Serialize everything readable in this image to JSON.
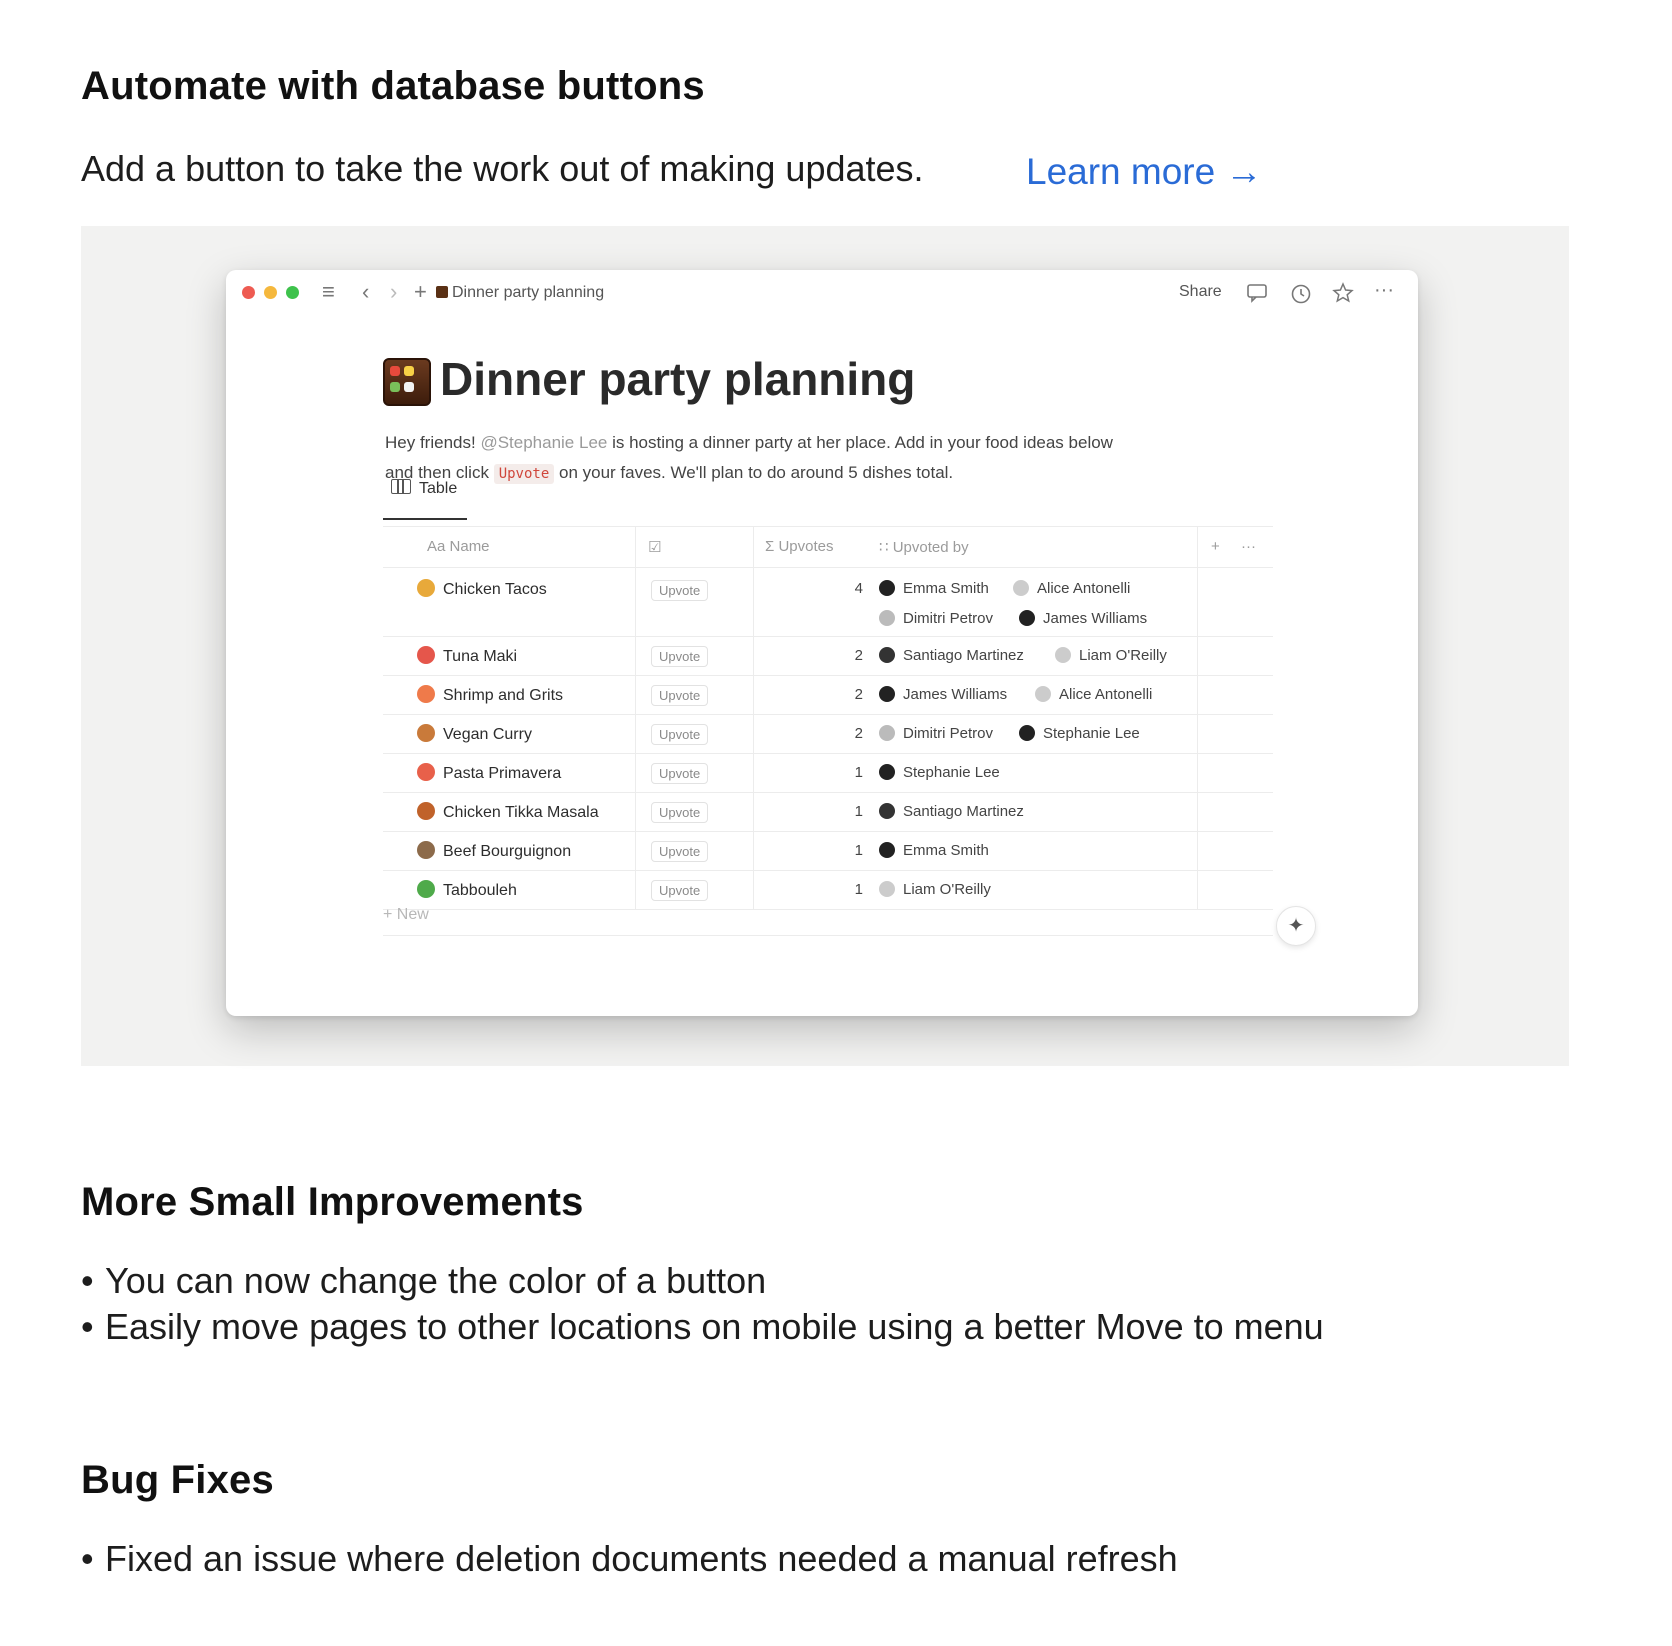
{
  "section1": {
    "title": "Automate with database buttons",
    "lead": "Add a button to take the work out of making updates.",
    "learn_more": "Learn more →"
  },
  "window": {
    "breadcrumb": "Dinner party planning",
    "share": "Share",
    "page_title": "Dinner party planning",
    "desc_line1_a": "Hey friends! ",
    "desc_mention": "@Stephanie Lee",
    "desc_line1_b": " is hosting a dinner party at her place. Add in your food ideas below",
    "desc_line2_a": "and then click ",
    "desc_code": "Upvote",
    "desc_line2_b": " on your faves. We'll plan to do around 5 dishes total.",
    "tab": "Table",
    "columns": {
      "name": "Aa  Name",
      "button_col": "☑",
      "upvotes": "Σ  Upvotes",
      "upvoted_by": "∷  Upvoted by"
    },
    "add_column": "+",
    "more": "···",
    "button_label": "Upvote",
    "rows": [
      {
        "name": "Chicken Tacos",
        "count": "4",
        "people": [
          "Emma Smith",
          "Alice Antonelli",
          "Dimitri Petrov",
          "James Williams"
        ]
      },
      {
        "name": "Tuna Maki",
        "count": "2",
        "people": [
          "Santiago Martinez",
          "Liam O'Reilly"
        ]
      },
      {
        "name": "Shrimp and Grits",
        "count": "2",
        "people": [
          "James Williams",
          "Alice Antonelli"
        ]
      },
      {
        "name": "Vegan Curry",
        "count": "2",
        "people": [
          "Dimitri Petrov",
          "Stephanie Lee"
        ]
      },
      {
        "name": "Pasta Primavera",
        "count": "1",
        "people": [
          "Stephanie Lee"
        ]
      },
      {
        "name": "Chicken Tikka Masala",
        "count": "1",
        "people": [
          "Santiago Martinez"
        ]
      },
      {
        "name": "Beef Bourguignon",
        "count": "1",
        "people": [
          "Emma Smith"
        ]
      },
      {
        "name": "Tabbouleh",
        "count": "1",
        "people": [
          "Liam O'Reilly"
        ]
      }
    ],
    "new_row": "+ New",
    "sparkle": "✦"
  },
  "section2": {
    "title": "More Small Improvements",
    "bullets": [
      "You can now change the color of a button",
      "Easily move pages to other locations on mobile using a better Move to menu"
    ]
  },
  "section3": {
    "title": "Bug Fixes",
    "bullets": [
      "Fixed an issue where deletion documents needed a manual refresh"
    ]
  },
  "colors": {
    "link": "#2a6bd6",
    "traffic_red": "#ee5b52",
    "traffic_yellow": "#f5b83d",
    "traffic_green": "#3ec24c",
    "code_red": "#d0463b"
  }
}
